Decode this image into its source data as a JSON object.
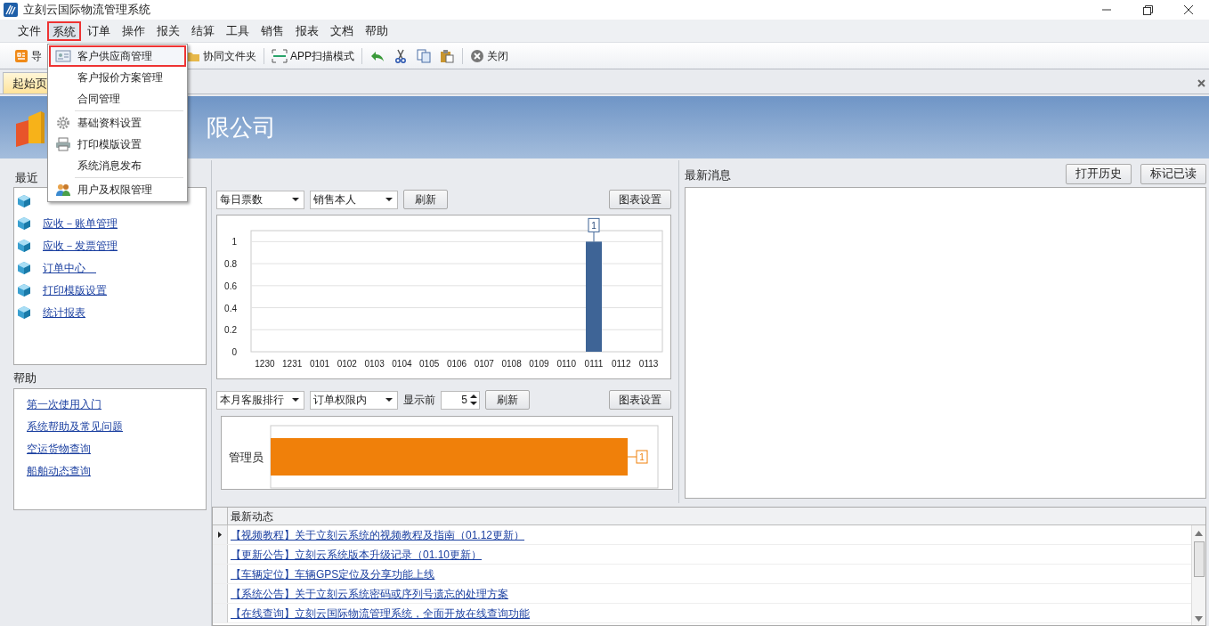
{
  "window": {
    "title": "立刻云国际物流管理系统"
  },
  "menu_bar": [
    {
      "label": "文件",
      "selected": false
    },
    {
      "label": "系统",
      "selected": true
    },
    {
      "label": "订单",
      "selected": false
    },
    {
      "label": "操作",
      "selected": false
    },
    {
      "label": "报关",
      "selected": false
    },
    {
      "label": "结算",
      "selected": false
    },
    {
      "label": "工具",
      "selected": false
    },
    {
      "label": "销售",
      "selected": false
    },
    {
      "label": "报表",
      "selected": false
    },
    {
      "label": "文档",
      "selected": false
    },
    {
      "label": "帮助",
      "selected": false
    }
  ],
  "toolbar": [
    {
      "kind": "button",
      "label": "导"
    },
    {
      "kind": "button",
      "label": "协同文件夹"
    },
    {
      "kind": "button",
      "label": "APP扫描模式"
    },
    {
      "kind": "icon"
    },
    {
      "kind": "icon"
    },
    {
      "kind": "icon"
    },
    {
      "kind": "icon"
    },
    {
      "kind": "button",
      "label": "关闭"
    }
  ],
  "dropdown_menu": [
    {
      "label": "客户供应商管理",
      "selected": true,
      "separator_after": false
    },
    {
      "label": "客户报价方案管理",
      "selected": false,
      "separator_after": false
    },
    {
      "label": "合同管理",
      "selected": false,
      "separator_after": true
    },
    {
      "label": "基础资料设置",
      "selected": false,
      "separator_after": false
    },
    {
      "label": "打印模版设置",
      "selected": false,
      "separator_after": false
    },
    {
      "label": "系统消息发布",
      "selected": false,
      "separator_after": true
    },
    {
      "label": "用户及权限管理",
      "selected": false,
      "separator_after": false
    }
  ],
  "tabs": [
    {
      "label": "起始页",
      "selected": true
    }
  ],
  "banner": {
    "company": "限公司"
  },
  "recent": {
    "title": "最近",
    "items": [
      {
        "kind": "covered"
      },
      {
        "kind": "link",
        "label": "应收－账单管理"
      },
      {
        "kind": "link",
        "label": "应收－发票管理"
      },
      {
        "kind": "link",
        "label": "订单中心　"
      },
      {
        "kind": "link",
        "label": "打印模版设置"
      },
      {
        "kind": "link",
        "label": "统计报表"
      }
    ]
  },
  "help": {
    "title": "帮助",
    "items": [
      "第一次使用入门",
      "系统帮助及常见问题",
      "空运货物查询",
      "船舶动态查询"
    ]
  },
  "chart_panel_1": {
    "selects": [
      "每日票数",
      "销售本人"
    ],
    "refresh": "刷新",
    "settings": "图表设置",
    "chart_data": {
      "type": "bar",
      "categories": [
        "1230",
        "1231",
        "0101",
        "0102",
        "0103",
        "0104",
        "0105",
        "0106",
        "0107",
        "0108",
        "0109",
        "0110",
        "0111",
        "0112",
        "0113"
      ],
      "series": [
        {
          "color": "#3e6496",
          "values": [
            0,
            0,
            0,
            0,
            0,
            0,
            0,
            0,
            0,
            0,
            0,
            0,
            1,
            0,
            0
          ]
        }
      ],
      "grid": true,
      "ylim": [
        0,
        1.1
      ],
      "yticks": [
        {
          "value": 0,
          "label": "0"
        },
        {
          "value": 0.2,
          "label": "0.2"
        },
        {
          "value": 0.4,
          "label": "0.4"
        },
        {
          "value": 0.6,
          "label": "0.6"
        },
        {
          "value": 0.8,
          "label": "0.8"
        },
        {
          "value": 1,
          "label": "1"
        }
      ],
      "annotations": [
        {
          "x": "0111",
          "text": "1"
        }
      ]
    }
  },
  "chart_panel_2": {
    "selects": [
      "本月客服排行",
      "订单权限内"
    ],
    "show_top_label": "显示前",
    "show_top_value": "5",
    "refresh": "刷新",
    "settings": "图表设置",
    "chart_data": {
      "type": "bar",
      "orientation": "horizontal",
      "categories": [
        "管理员"
      ],
      "series": [
        {
          "color": "#f0800a",
          "values": [
            1
          ]
        }
      ],
      "data_labels": true
    }
  },
  "messages": {
    "title": "最新消息",
    "buttons": [
      "打开历史",
      "标记已读"
    ]
  },
  "news": {
    "column": "最新动态",
    "rows": [
      {
        "text": "【视频教程】关于立刻云系统的视频教程及指南（01.12更新）",
        "current": true
      },
      {
        "text": "【更新公告】立刻云系统版本升级记录（01.10更新）",
        "current": false
      },
      {
        "text": "【车辆定位】车辆GPS定位及分享功能上线",
        "current": false
      },
      {
        "text": "【系统公告】关于立刻云系统密码或序列号遗忘的处理方案",
        "current": false
      },
      {
        "text": "【在线查询】立刻云国际物流管理系统，全面开放在线查询功能",
        "current": false
      }
    ]
  }
}
